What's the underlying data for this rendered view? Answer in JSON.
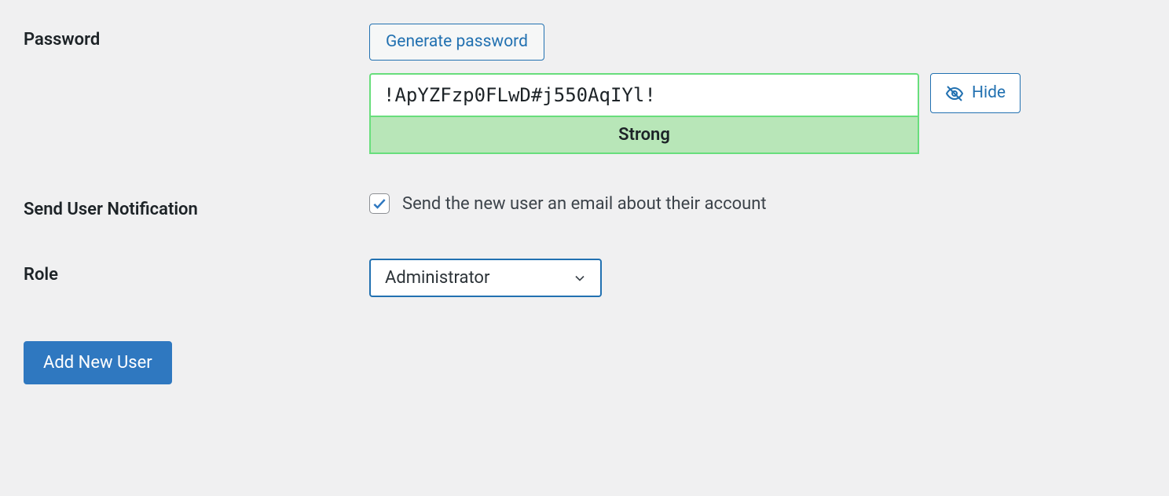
{
  "labels": {
    "password": "Password",
    "notification": "Send User Notification",
    "role": "Role"
  },
  "buttons": {
    "generate": "Generate password",
    "hide": "Hide",
    "submit": "Add New User"
  },
  "password": {
    "value": "!ApYZFzp0FLwD#j550AqIYl!",
    "strength": "Strong"
  },
  "notification": {
    "description": "Send the new user an email about their account",
    "checked": true
  },
  "role": {
    "selected": "Administrator"
  }
}
